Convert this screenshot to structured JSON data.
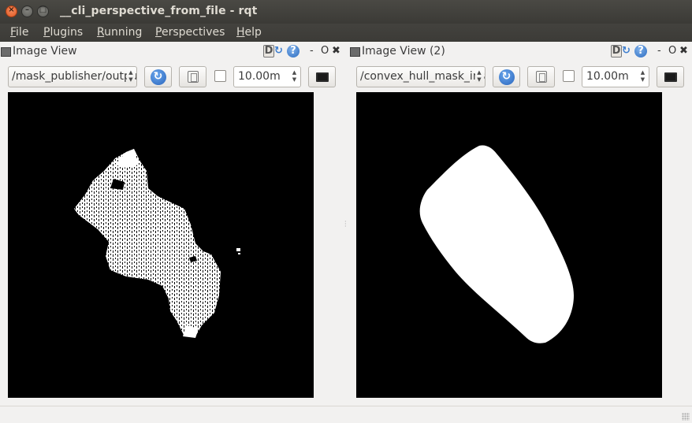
{
  "window": {
    "title": "__cli_perspective_from_file - rqt",
    "controls": [
      "close",
      "minimize",
      "maximize"
    ]
  },
  "menu": [
    "File",
    "Plugins",
    "Running",
    "Perspectives",
    "Help"
  ],
  "panes": [
    {
      "title": "Image View",
      "dock_icons": {
        "d": "D",
        "reload": "↻",
        "help": "?",
        "minimize": "-",
        "float": "O",
        "close": "✖"
      },
      "topic": "/mask_publisher/output",
      "zoom_checked": false,
      "timeout_value": "10.00m"
    },
    {
      "title": "Image View (2)",
      "dock_icons": {
        "d": "D",
        "reload": "↻",
        "help": "?",
        "minimize": "-",
        "float": "O",
        "close": "✖"
      },
      "topic": "/convex_hull_mask_image",
      "zoom_checked": false,
      "timeout_value": "10.00m"
    }
  ],
  "icons": {
    "window_close": "close-icon",
    "window_minimize": "minimize-icon",
    "window_maximize": "maximize-icon",
    "refresh": "refresh-icon",
    "save": "save-icon",
    "pane_icon": "image-view-icon",
    "fit": "fit-window-icon"
  },
  "colors": {
    "titlebar": "#3c3b37",
    "menu_text": "#dfdbd2",
    "close_button": "#e05a25",
    "refresh_blue": "#2a66bd",
    "image_bg": "#000000",
    "mask_fg": "#ffffff"
  }
}
